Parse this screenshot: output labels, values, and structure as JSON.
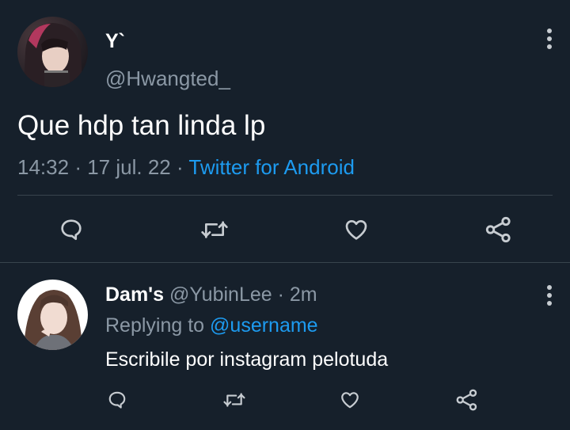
{
  "main_tweet": {
    "display_name": "Y`",
    "handle": "@Hwangted_",
    "text": "Que hdp tan linda lp",
    "time": "14:32",
    "date": "17 jul. 22",
    "client": "Twitter for Android",
    "separator": "·"
  },
  "reply": {
    "display_name": "Dam's",
    "handle": "@YubinLee",
    "age": "2m",
    "separator": "·",
    "replying_to_label": "Replying to",
    "replying_to_user": "@username",
    "text": "Escribile por instagram pelotuda"
  },
  "colors": {
    "background": "#16202b",
    "divider": "#38444d",
    "muted_text": "#8b98a5",
    "link": "#1d9bf0",
    "icon": "#c7ccd1"
  },
  "icons": [
    "reply-icon",
    "retweet-icon",
    "like-icon",
    "share-icon",
    "more-icon"
  ]
}
